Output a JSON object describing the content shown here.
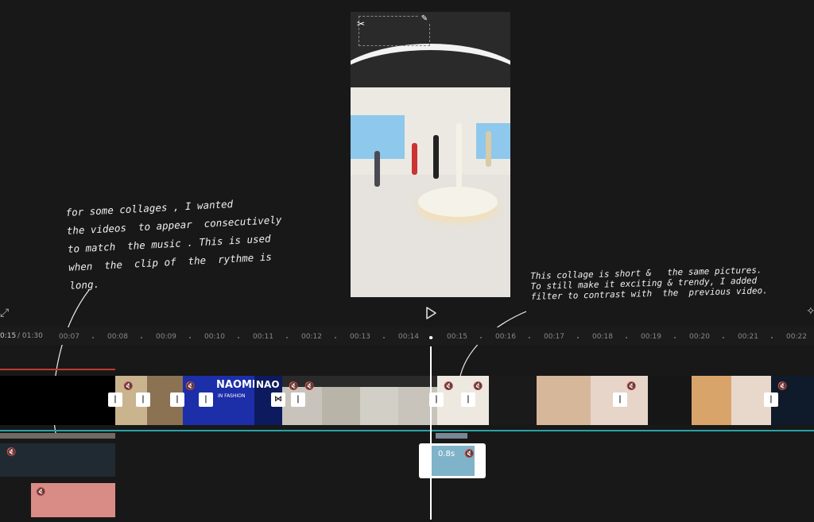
{
  "timeline": {
    "current_time": "0:15",
    "total_time": "/ 01:30",
    "ticks": [
      "00:07",
      "00:08",
      "00:09",
      "00:10",
      "00:11",
      "00:12",
      "00:13",
      "00:14",
      "00:15",
      "00:16",
      "00:17",
      "00:18",
      "00:19",
      "00:20",
      "00:21",
      "00:22"
    ]
  },
  "overlay_clip": {
    "duration": "0.8s"
  },
  "clip_text": {
    "naomi": "NAOMI",
    "in_fashion": "IN FASHION",
    "nao": "NAO"
  },
  "annotations": {
    "left": "for some collages , I wanted\nthe videos  to appear  consecutively\nto match  the music . This is used\nwhen  the  clip of  the  rythme is\nlong.",
    "right": "This collage is short &   the same pictures.\nTo still make it exciting & trendy, I added\nfilter to contrast with  the  previous video."
  },
  "colors": {
    "track_line": "#27a3a8",
    "red_line": "#c0392b",
    "background": "#181818"
  },
  "icons": [
    "capcut-logo-icon",
    "edit-pencil-icon",
    "play-icon",
    "expand-icon",
    "sparkle-icon",
    "mute-icon",
    "transition-icon"
  ]
}
